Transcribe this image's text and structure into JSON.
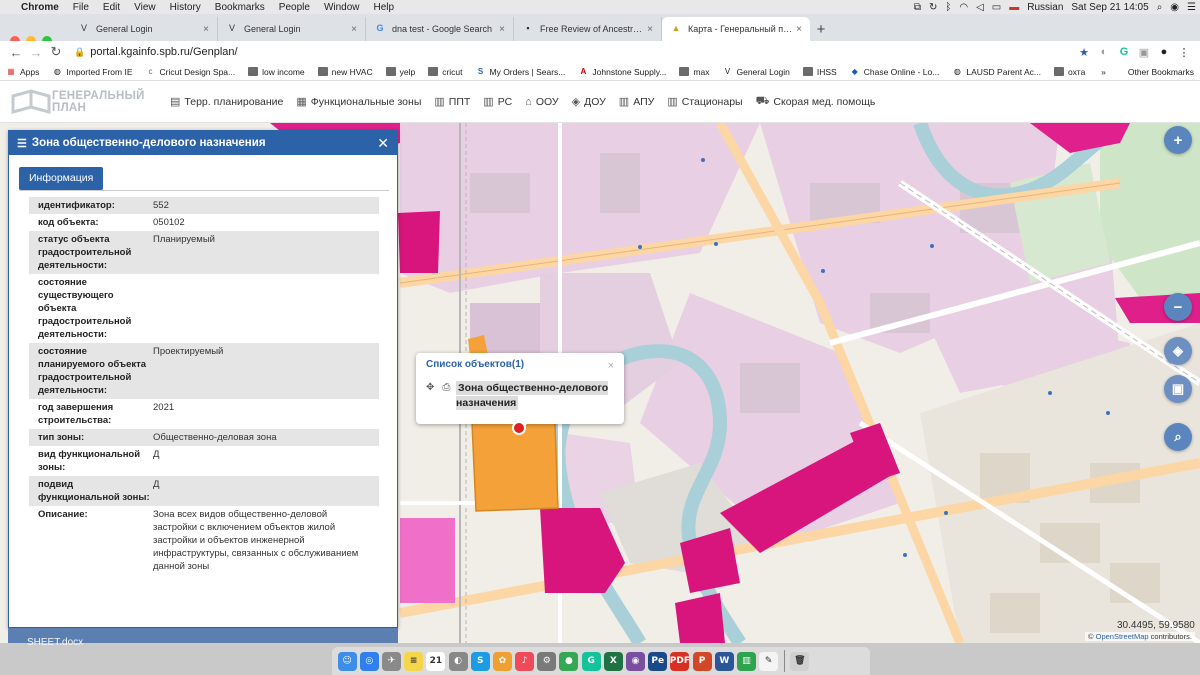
{
  "menubar": {
    "apple_glyph": "",
    "app": "Chrome",
    "items": [
      "File",
      "Edit",
      "View",
      "History",
      "Bookmarks",
      "People",
      "Window",
      "Help"
    ],
    "input_source": "Russian",
    "clock": "Sat Sep 21  14:05"
  },
  "tabs": [
    {
      "title": "General Login",
      "favicon": "V",
      "active": false
    },
    {
      "title": "General Login",
      "favicon": "V",
      "active": false
    },
    {
      "title": "dna test - Google Search",
      "favicon": "G",
      "active": false
    },
    {
      "title": "Free Review of Ancestry Dna T",
      "favicon": "▪",
      "active": false
    },
    {
      "title": "Карта - Генеральный план Са",
      "favicon": "▲",
      "active": true
    }
  ],
  "toolbar": {
    "url": "portal.kgainfo.spb.ru/Genplan/"
  },
  "bookmarks": [
    {
      "label": "Apps",
      "icon": "apps-icon"
    },
    {
      "label": "Imported From IE",
      "icon": "globe-icon"
    },
    {
      "label": "Cricut Design Spa...",
      "icon": "cricut-icon"
    },
    {
      "label": "low income",
      "icon": "folder-icon"
    },
    {
      "label": "new HVAC",
      "icon": "folder-icon"
    },
    {
      "label": "yelp",
      "icon": "folder-icon"
    },
    {
      "label": "cricut",
      "icon": "folder-icon"
    },
    {
      "label": "My Orders | Sears...",
      "icon": "sears-icon"
    },
    {
      "label": "Johnstone Supply...",
      "icon": "johnstone-icon"
    },
    {
      "label": "max",
      "icon": "folder-icon"
    },
    {
      "label": "General Login",
      "icon": "v-icon"
    },
    {
      "label": "IHSS",
      "icon": "folder-icon"
    },
    {
      "label": "Chase Online - Lo...",
      "icon": "chase-icon"
    },
    {
      "label": "LAUSD Parent Ac...",
      "icon": "globe-icon"
    },
    {
      "label": "охта",
      "icon": "folder-icon"
    }
  ],
  "other_bookmarks": "Other Bookmarks",
  "app": {
    "logo_line1": "ГЕНЕРАЛЬНЫЙ",
    "logo_line2": "ПЛАН",
    "nav": [
      {
        "label": "Терр. планирование",
        "icon": "document-icon"
      },
      {
        "label": "Функциональные зоны",
        "icon": "layers-icon"
      },
      {
        "label": "ППТ",
        "icon": "grid-icon"
      },
      {
        "label": "РС",
        "icon": "grid-icon"
      },
      {
        "label": "ООУ",
        "icon": "bank-icon"
      },
      {
        "label": "ДОУ",
        "icon": "graduation-icon"
      },
      {
        "label": "АПУ",
        "icon": "grid-icon"
      },
      {
        "label": "Стационары",
        "icon": "grid-icon"
      },
      {
        "label": "Скорая мед. помощь",
        "icon": "ambulance-icon"
      }
    ]
  },
  "panel": {
    "title": "Зона общественно-делового назначения",
    "tab": "Информация",
    "properties": [
      {
        "key": "идентификатор:",
        "value": "552"
      },
      {
        "key": "код объекта:",
        "value": "050102"
      },
      {
        "key": "статус объекта градостроительной деятельности:",
        "value": "Планируемый"
      },
      {
        "key": "состояние существующего объекта градостроительной деятельности:",
        "value": ""
      },
      {
        "key": "состояние планируемого объекта градостроительной деятельности:",
        "value": "Проектируемый"
      },
      {
        "key": "год завершения строительства:",
        "value": "2021"
      },
      {
        "key": "тип зоны:",
        "value": "Общественно-деловая зона"
      },
      {
        "key": "вид функциональной зоны:",
        "value": "Д"
      },
      {
        "key": "подвид функциональной зоны:",
        "value": "Д"
      },
      {
        "key": "Описание:",
        "value": "Зона всех видов общественно-деловой застройки с включением объектов жилой застройки и объектов инженерной инфраструктуры, связанных с обслуживанием данной зоны"
      }
    ]
  },
  "popup": {
    "title": "Список объектов(1)",
    "close": "×",
    "object": "Зона общественно-делового назначения"
  },
  "map_controls": {
    "zoom_in": "+",
    "zoom_out": "−"
  },
  "map": {
    "coords": "30.4495, 59.9580",
    "attribution_prefix": "© ",
    "attribution_link": "OpenStreetMap",
    "attribution_suffix": " contributors."
  },
  "desktop": {
    "file": "SHEET.docx"
  },
  "dock_apps": [
    {
      "name": "finder-icon",
      "color": "#3d8ee8",
      "glyph": "☺"
    },
    {
      "name": "safari-icon",
      "color": "#2f80ed",
      "glyph": "◎"
    },
    {
      "name": "launchpad-icon",
      "color": "#8a8a8a",
      "glyph": "✈"
    },
    {
      "name": "notes-icon",
      "color": "#f5d54a",
      "glyph": "≡"
    },
    {
      "name": "calendar-icon",
      "color": "#ffffff",
      "glyph": "21"
    },
    {
      "name": "preview-icon",
      "color": "#888888",
      "glyph": "◐"
    },
    {
      "name": "skype-icon",
      "color": "#1c9ce5",
      "glyph": "S"
    },
    {
      "name": "photos-icon",
      "color": "#f0a030",
      "glyph": "✿"
    },
    {
      "name": "music-icon",
      "color": "#f04a5a",
      "glyph": "♪"
    },
    {
      "name": "system-preferences-icon",
      "color": "#7a7a7a",
      "glyph": "⚙"
    },
    {
      "name": "chrome-icon",
      "color": "#34a853",
      "glyph": "●"
    },
    {
      "name": "grammarly-icon",
      "color": "#15c39a",
      "glyph": "G"
    },
    {
      "name": "excel-icon",
      "color": "#1f7244",
      "glyph": "X"
    },
    {
      "name": "tor-icon",
      "color": "#7a4fa0",
      "glyph": "◉"
    },
    {
      "name": "pearson-icon",
      "color": "#1a4a8a",
      "glyph": "Pe"
    },
    {
      "name": "pdf-icon",
      "color": "#d93025",
      "glyph": "PDF"
    },
    {
      "name": "powerpoint-icon",
      "color": "#d24726",
      "glyph": "P"
    },
    {
      "name": "word-icon",
      "color": "#2b579a",
      "glyph": "W"
    },
    {
      "name": "numbers-icon",
      "color": "#2ea44f",
      "glyph": "▥"
    },
    {
      "name": "pages-icon",
      "color": "#f4f4f4",
      "glyph": "✎"
    },
    {
      "name": "trash-icon",
      "color": "#d0d0d0",
      "glyph": "🗑"
    }
  ]
}
